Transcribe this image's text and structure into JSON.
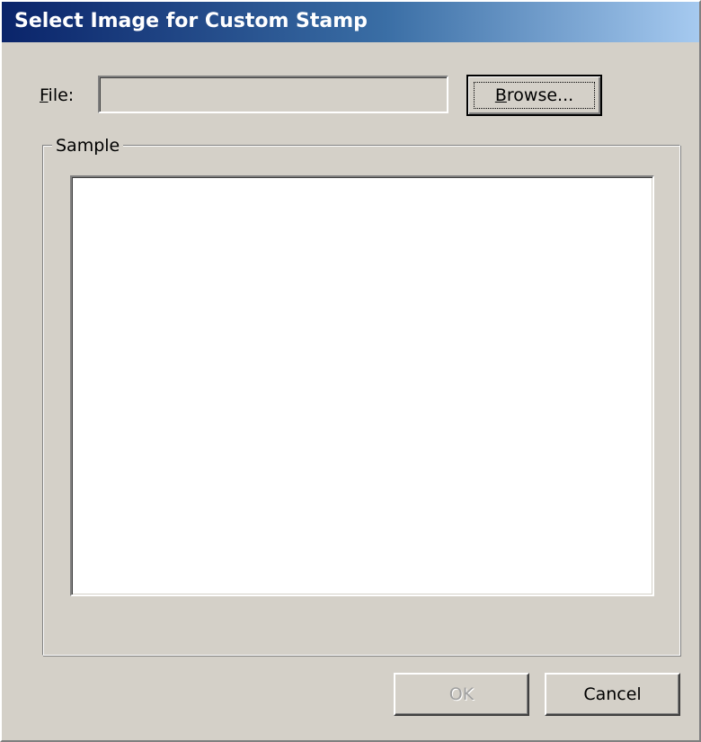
{
  "window": {
    "title": "Select Image for Custom Stamp"
  },
  "file": {
    "label": "File:",
    "value": "",
    "browse_label": "Browse..."
  },
  "sample": {
    "label": "Sample"
  },
  "buttons": {
    "ok_label": "OK",
    "cancel_label": "Cancel",
    "ok_enabled": false
  },
  "colors": {
    "dialog_face": "#d4d0c8",
    "titlebar_start": "#0a246a",
    "titlebar_end": "#a6caf0",
    "sample_background": "#ffffff",
    "disabled_text": "#a0a0a0"
  }
}
